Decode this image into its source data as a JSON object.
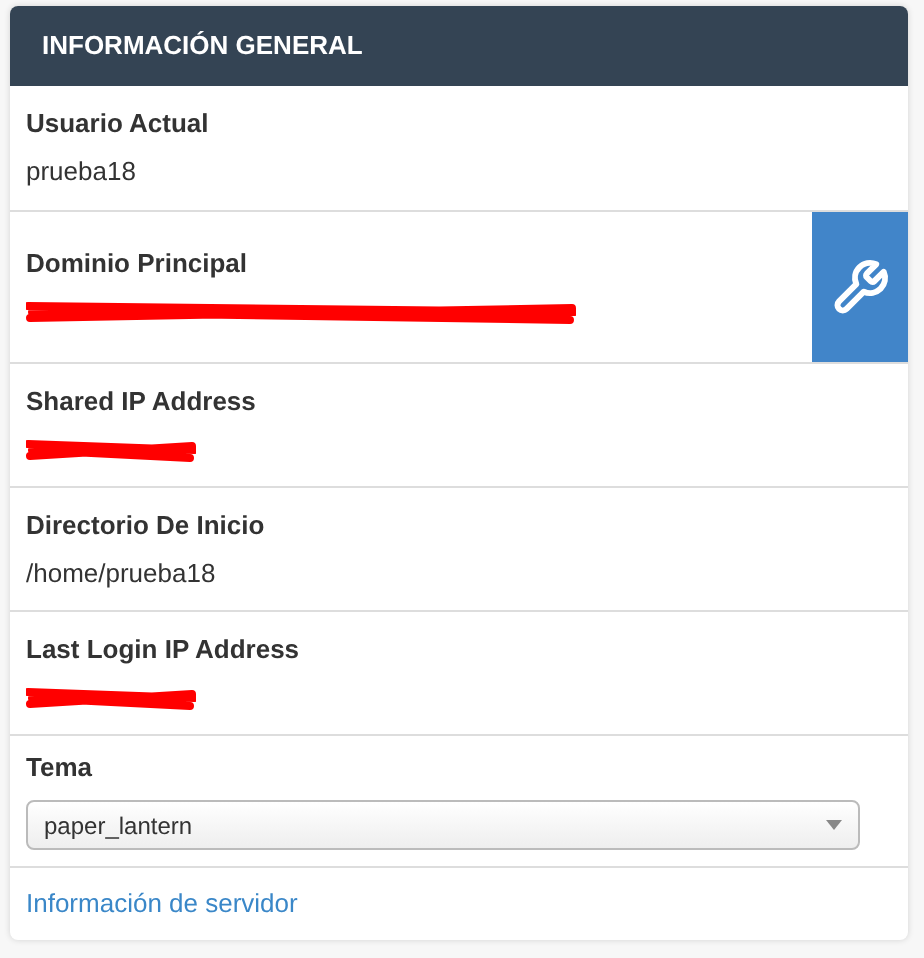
{
  "panel": {
    "title": "INFORMACIÓN GENERAL"
  },
  "rows": [
    {
      "kind": "text",
      "label": "Usuario Actual",
      "value": "prueba18"
    },
    {
      "kind": "redacted-link",
      "label": "Dominio Principal",
      "tool_button": true
    },
    {
      "kind": "redacted",
      "label": "Shared IP Address"
    },
    {
      "kind": "text",
      "label": "Directorio De Inicio",
      "value": "/home/prueba18"
    },
    {
      "kind": "redacted",
      "label": "Last Login IP Address"
    },
    {
      "kind": "select",
      "label": "Tema",
      "value": "paper_lantern"
    }
  ],
  "footer_link": "Información de servidor"
}
